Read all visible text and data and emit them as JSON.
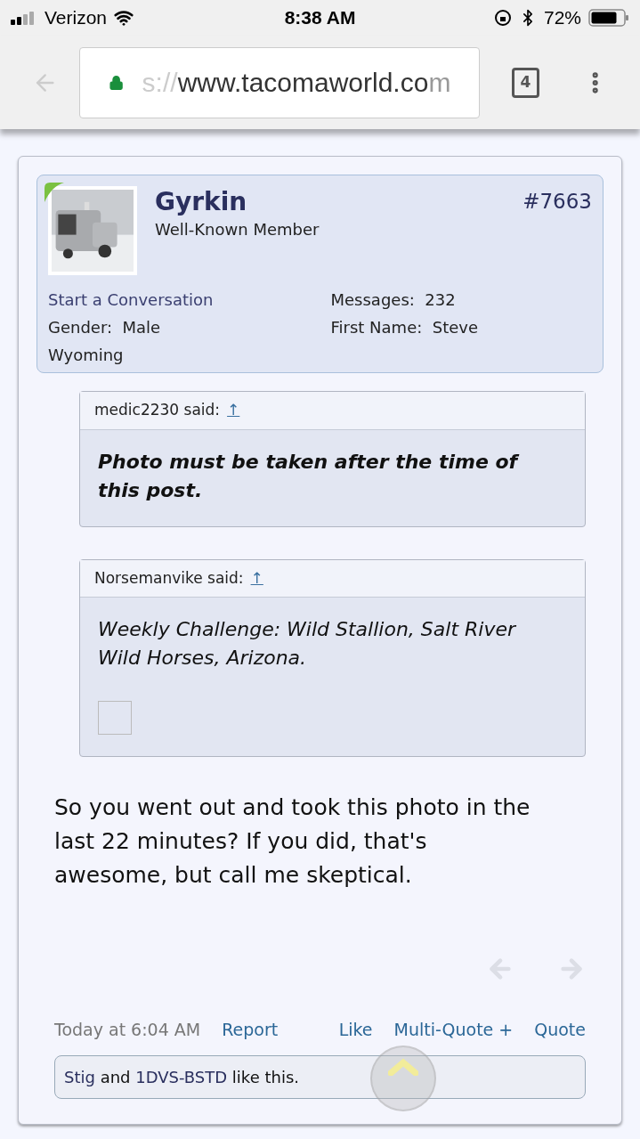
{
  "status_bar": {
    "carrier": "Verizon",
    "time": "8:38 AM",
    "battery": "72%"
  },
  "browser": {
    "url_faded": "s://",
    "url": "www.tacomaworld.co",
    "url_tail": "m",
    "tab_count": "4"
  },
  "post": {
    "author": "Gyrkin",
    "role": "Well-Known Member",
    "number": "#7663",
    "start_conversation": "Start a Conversation",
    "info_left": [
      {
        "label": "Gender:",
        "value": "Male"
      },
      {
        "label": "Wyoming"
      }
    ],
    "info_right": [
      {
        "label": "Messages:",
        "value": "232"
      },
      {
        "label": "First Name:",
        "value": "Steve"
      }
    ],
    "quotes": [
      {
        "author": "medic2230 said:",
        "arrow": "↑",
        "text": "Photo must be taken after the time of this post.",
        "kind": "strong",
        "has_image": false
      },
      {
        "author": "Norsemanvike said:",
        "arrow": "↑",
        "text": "Weekly Challenge: Wild Stallion, Salt River Wild Horses, Arizona.",
        "kind": "plain",
        "has_image": true
      }
    ],
    "body": "So you went out and took this photo in the last 22 minutes? If you did, that's awesome, but call me skeptical.",
    "time": "Today at 6:04 AM",
    "report": "Report",
    "actions": [
      "Like",
      "Multi-Quote +",
      "Quote"
    ],
    "likes": {
      "users": [
        "Stig",
        "1DVS-BSTD"
      ],
      "joiner": "and",
      "suffix": "like this."
    }
  }
}
